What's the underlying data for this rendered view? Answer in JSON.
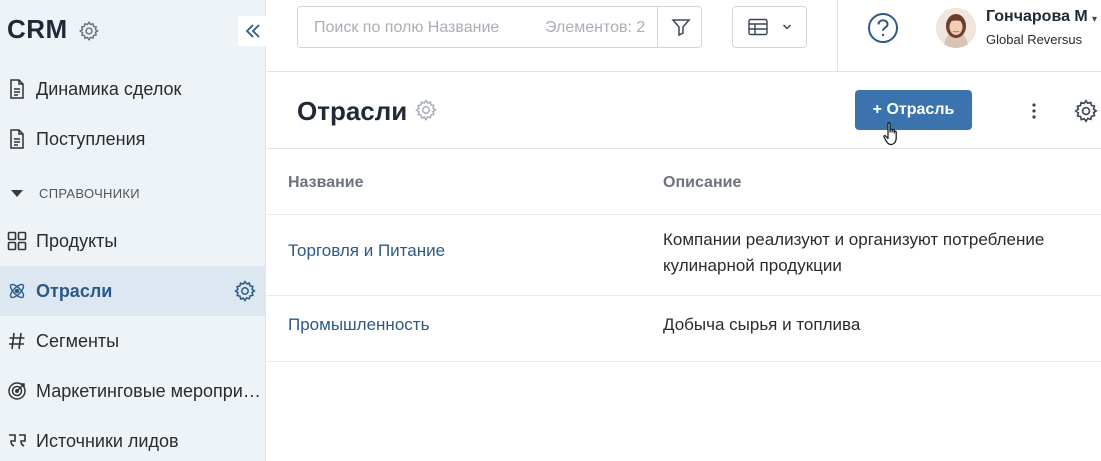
{
  "sidebar": {
    "title": "CRM",
    "items": [
      {
        "label": "Динамика сделок",
        "icon": "document-icon"
      },
      {
        "label": "Поступления",
        "icon": "document-icon"
      },
      {
        "label": "Продукты",
        "icon": "grid-icon"
      },
      {
        "label": "Отрасли",
        "icon": "atom-icon",
        "active": true
      },
      {
        "label": "Сегменты",
        "icon": "hash-icon"
      },
      {
        "label": "Маркетинговые мероприятия",
        "icon": "target-icon"
      },
      {
        "label": "Источники лидов",
        "icon": "quote-icon"
      }
    ],
    "section_label": "СПРАВОЧНИКИ"
  },
  "topbar": {
    "search_placeholder": "Поиск по полю Название",
    "count_label": "Элементов: 2",
    "user_name": "Гончарова М",
    "user_org": "Global Reversus"
  },
  "page": {
    "title": "Отрасли",
    "add_button": "+ Отрасль"
  },
  "table": {
    "columns": [
      "Название",
      "Описание"
    ],
    "rows": [
      {
        "name": "Торговля и Питание",
        "description": "Компании реализуют и организуют потребление кулинарной продукции"
      },
      {
        "name": "Промышленность",
        "description": "Добыча сырья и топлива"
      }
    ]
  },
  "colors": {
    "accent": "#3a73ad",
    "link": "#2b5a87",
    "sidebar_bg": "#eef3f8",
    "active_bg": "#dde7f2"
  }
}
